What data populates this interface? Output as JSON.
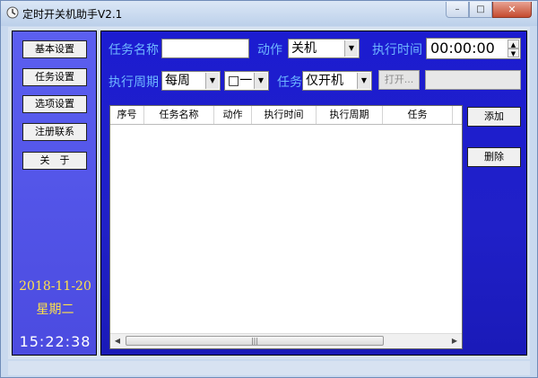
{
  "window": {
    "title": "定时开关机助手V2.1",
    "controls": {
      "minimize": "–",
      "maximize": "□",
      "close": "✕"
    }
  },
  "sidebar": {
    "buttons": [
      "基本设置",
      "任务设置",
      "选项设置",
      "注册联系",
      "关　于"
    ],
    "date": "2018-11-20",
    "weekday": "星期二",
    "time": "15:22:38"
  },
  "form": {
    "task_name_label": "任务名称",
    "task_name_value": "",
    "action_label": "动作",
    "action_value": "关机",
    "exec_time_label": "执行时间",
    "exec_time_value": "00:00:00",
    "cycle_label": "执行周期",
    "cycle_value": "每周",
    "day_value": "□一",
    "task_label": "任务",
    "task_value": "仅开机",
    "open_button": "打开...",
    "path_value": ""
  },
  "table": {
    "columns": [
      "序号",
      "任务名称",
      "动作",
      "执行时间",
      "执行周期",
      "任务"
    ],
    "rows": []
  },
  "actions": {
    "add": "添加",
    "delete": "删除"
  },
  "colors": {
    "main_bg": "#2020c8",
    "sidebar_bg": "#5b5ff0",
    "label": "#6fb7ff",
    "date_text": "#ffe24a"
  }
}
